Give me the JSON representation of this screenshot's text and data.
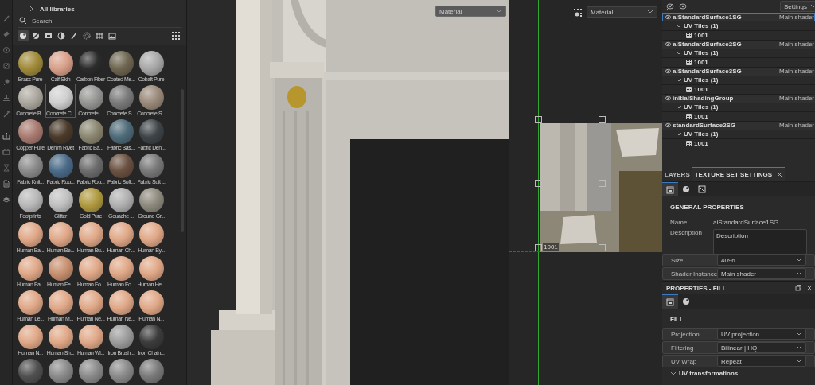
{
  "shelf": {
    "breadcrumb": "All libraries",
    "search": {
      "placeholder": "Search"
    },
    "filters": [
      {
        "kind": "material",
        "selected": true
      },
      {
        "kind": "smart-material",
        "selected": false
      },
      {
        "kind": "texture",
        "selected": false
      },
      {
        "kind": "mask",
        "selected": false
      },
      {
        "kind": "brush",
        "selected": false
      },
      {
        "kind": "particle",
        "selected": false
      },
      {
        "kind": "filter",
        "selected": false
      },
      {
        "kind": "environment",
        "selected": false
      }
    ],
    "materials": [
      {
        "name": "Brass Pure",
        "color": "#a08a3a",
        "selected": false
      },
      {
        "name": "Calf Skin",
        "color": "#d9a08a",
        "selected": false
      },
      {
        "name": "Carbon Fiber",
        "color": "#2c2c2c",
        "selected": false
      },
      {
        "name": "Coated Me...",
        "color": "#6e6650",
        "selected": false
      },
      {
        "name": "Cobalt Pure",
        "color": "#a8a8a8",
        "selected": false
      },
      {
        "name": "Concrete B...",
        "color": "#aca89f",
        "selected": false
      },
      {
        "name": "Concrete C...",
        "color": "#cfcfcf",
        "selected": true
      },
      {
        "name": "Concrete ...",
        "color": "#969694",
        "selected": false
      },
      {
        "name": "Concrete S...",
        "color": "#7a7a7a",
        "selected": false
      },
      {
        "name": "Concrete S...",
        "color": "#9a8a7a",
        "selected": false
      },
      {
        "name": "Copper Pure",
        "color": "#a87a70",
        "selected": false
      },
      {
        "name": "Denim Rivet",
        "color": "#4a3a2a",
        "selected": false
      },
      {
        "name": "Fabric Ba...",
        "color": "#8a8670",
        "selected": false
      },
      {
        "name": "Fabric Bas...",
        "color": "#4e6a78",
        "selected": false
      },
      {
        "name": "Fabric Den...",
        "color": "#3e4448",
        "selected": false
      },
      {
        "name": "Fabric Knit...",
        "color": "#8a8a8a",
        "selected": false
      },
      {
        "name": "Fabric Rou...",
        "color": "#4a6a88",
        "selected": false
      },
      {
        "name": "Fabric Rou...",
        "color": "#6c6c6c",
        "selected": false
      },
      {
        "name": "Fabric Soft...",
        "color": "#6a5040",
        "selected": false
      },
      {
        "name": "Fabric Suit ...",
        "color": "#787878",
        "selected": false
      },
      {
        "name": "Footprints",
        "color": "#b8b8b8",
        "selected": false
      },
      {
        "name": "Glitter",
        "color": "#c0c0c0",
        "selected": false
      },
      {
        "name": "Gold Pure",
        "color": "#b09a40",
        "selected": false
      },
      {
        "name": "Gouache ...",
        "color": "#b0b0b0",
        "selected": false
      },
      {
        "name": "Ground Gr...",
        "color": "#8e8a7e",
        "selected": false
      },
      {
        "name": "Human Ba...",
        "color": "#e0a888",
        "selected": false
      },
      {
        "name": "Human Be...",
        "color": "#e0a888",
        "selected": false
      },
      {
        "name": "Human Bu...",
        "color": "#e0a888",
        "selected": false
      },
      {
        "name": "Human Ch...",
        "color": "#e0a888",
        "selected": false
      },
      {
        "name": "Human Ey...",
        "color": "#e0a888",
        "selected": false
      },
      {
        "name": "Human Fa...",
        "color": "#e0a888",
        "selected": false
      },
      {
        "name": "Human Fe...",
        "color": "#c89070",
        "selected": false
      },
      {
        "name": "Human Fo...",
        "color": "#e0a888",
        "selected": false
      },
      {
        "name": "Human Fo...",
        "color": "#e0a888",
        "selected": false
      },
      {
        "name": "Human He...",
        "color": "#e0a888",
        "selected": false
      },
      {
        "name": "Human Le...",
        "color": "#e0a888",
        "selected": false
      },
      {
        "name": "Human M...",
        "color": "#e0a888",
        "selected": false
      },
      {
        "name": "Human Ne...",
        "color": "#e0a888",
        "selected": false
      },
      {
        "name": "Human Ne...",
        "color": "#e0a888",
        "selected": false
      },
      {
        "name": "Human N...",
        "color": "#e0a888",
        "selected": false
      },
      {
        "name": "Human N...",
        "color": "#e0a888",
        "selected": false
      },
      {
        "name": "Human Sh...",
        "color": "#e0a888",
        "selected": false
      },
      {
        "name": "Human Wi...",
        "color": "#e0a888",
        "selected": false
      },
      {
        "name": "Iron Brush...",
        "color": "#9c9c9c",
        "selected": false
      },
      {
        "name": "Iron Chain...",
        "color": "#3c3c3c",
        "selected": false
      },
      {
        "color": "#505050",
        "selected": false
      },
      {
        "color": "#8a8a8a",
        "selected": false
      },
      {
        "color": "#8a8a8a",
        "selected": false
      },
      {
        "color": "#8a8a8a",
        "selected": false
      },
      {
        "color": "#7a7a7a",
        "selected": false
      }
    ]
  },
  "viewport_3d": {
    "material_mode": "Material"
  },
  "viewport_2d": {
    "material_mode": "Material",
    "tile_label": "1001"
  },
  "texture_sets": {
    "settings": "Settings",
    "sets": [
      {
        "name": "aiStandardSurface1SG",
        "shader": "Main shader",
        "selected": true,
        "uv_group": {
          "label": "UV Tiles (1)",
          "expanded": true,
          "tiles": [
            "1001"
          ]
        }
      },
      {
        "name": "aiStandardSurface2SG",
        "shader": "Main shader",
        "selected": false,
        "uv_group": {
          "label": "UV Tiles (1)",
          "expanded": true,
          "tiles": [
            "1001"
          ]
        }
      },
      {
        "name": "aiStandardSurface3SG",
        "shader": "Main shader",
        "selected": false,
        "uv_group": {
          "label": "UV Tiles (1)",
          "expanded": true,
          "tiles": [
            "1001"
          ]
        }
      },
      {
        "name": "initialShadingGroup",
        "shader": "Main shader",
        "selected": false,
        "uv_group": {
          "label": "UV Tiles (1)",
          "expanded": true,
          "tiles": [
            "1001"
          ]
        }
      },
      {
        "name": "standardSurface2SG",
        "shader": "Main shader",
        "selected": false,
        "uv_group": {
          "label": "UV Tiles (1)",
          "expanded": true,
          "tiles": [
            "1001"
          ]
        }
      }
    ]
  },
  "tabs": [
    {
      "label": "LAYERS",
      "selected": false,
      "closable": false
    },
    {
      "label": "TEXTURE SET SETTINGS",
      "selected": true,
      "closable": true
    }
  ],
  "texture_set_settings": {
    "section": "GENERAL PROPERTIES",
    "fields": [
      {
        "kind": "text",
        "label": "Name",
        "value": "aiStandardSurface1SG"
      },
      {
        "kind": "textarea",
        "label": "Description",
        "placeholder": "Description"
      },
      {
        "kind": "dropdown",
        "label": "Size",
        "value": "4096"
      },
      {
        "kind": "dropdown",
        "label": "Shader Instance",
        "value": "Main shader"
      }
    ]
  },
  "properties_fill": {
    "title": "PROPERTIES - FILL",
    "section": "FILL",
    "fields": [
      {
        "kind": "dropdown",
        "label": "Projection",
        "value": "UV projection"
      },
      {
        "kind": "dropdown",
        "label": "Filtering",
        "value": "Bilinear | HQ"
      },
      {
        "kind": "dropdown",
        "label": "UV Wrap",
        "value": "Repeat"
      }
    ],
    "subsection": {
      "label": "UV transformations",
      "expanded": true
    }
  }
}
